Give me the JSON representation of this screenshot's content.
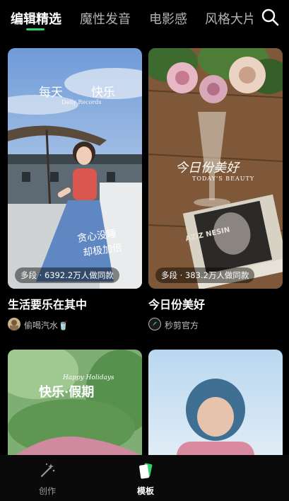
{
  "tabs": [
    {
      "label": "编辑精选",
      "active": true
    },
    {
      "label": "魔性发音",
      "active": false
    },
    {
      "label": "电影感",
      "active": false
    },
    {
      "label": "风格大片",
      "active": false
    }
  ],
  "search_icon": "search-icon",
  "cards": [
    {
      "title": "生活要乐在其中",
      "stats": "多段 · 6392.2万人做同款",
      "author": "偷喝汽水🥤",
      "overlay_text": [
        "每天",
        "快乐",
        "Daily Records",
        "贪心没睡",
        "却极加倍"
      ]
    },
    {
      "title": "今日份美好",
      "stats": "多段 · 383.2万人做同款",
      "author": "秒剪官方",
      "overlay_text": [
        "今日份美好",
        "TODAY'S BEAUTY",
        "AZIZ NESIN"
      ]
    },
    {
      "overlay_text": [
        "快乐·假期",
        "Happy Holidays"
      ]
    },
    {
      "overlay_text": []
    }
  ],
  "bottom_nav": [
    {
      "label": "创作",
      "icon": "magic-wand-icon",
      "active": false
    },
    {
      "label": "模板",
      "icon": "template-icon",
      "active": true
    }
  ],
  "colors": {
    "accent": "#2ed16b",
    "background": "#000000",
    "inactive_text": "#b3b3b3"
  }
}
